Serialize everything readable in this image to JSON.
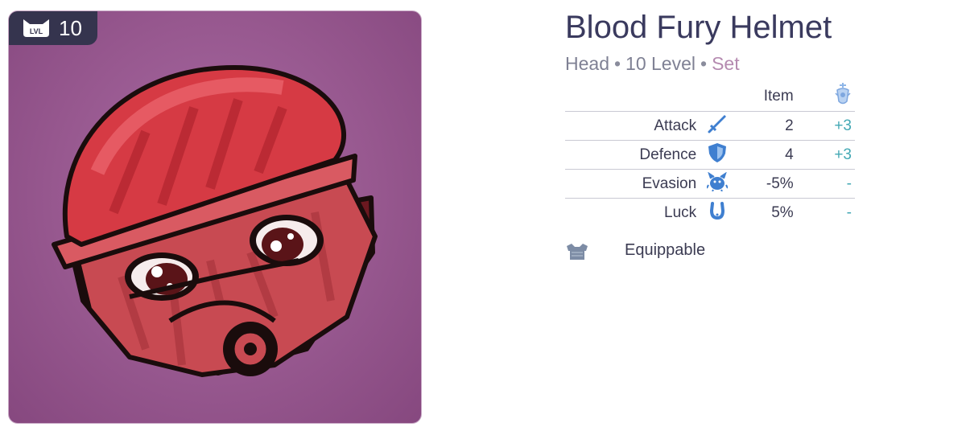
{
  "item": {
    "level_badge": "10",
    "name": "Blood Fury Helmet",
    "slot": "Head",
    "level_text": "10 Level",
    "separator": "•",
    "set_label": "Set"
  },
  "stats_table": {
    "header_item": "Item",
    "header_set_icon": "set-rune-icon",
    "rows": [
      {
        "label": "Attack",
        "icon": "sword-icon",
        "value": "2",
        "bonus": "+3"
      },
      {
        "label": "Defence",
        "icon": "shield-icon",
        "value": "4",
        "bonus": "+3"
      },
      {
        "label": "Evasion",
        "icon": "evasion-icon",
        "value": "-5%",
        "bonus": "-"
      },
      {
        "label": "Luck",
        "icon": "horseshoe-icon",
        "value": "5%",
        "bonus": "-"
      }
    ]
  },
  "equip": {
    "icon": "armor-icon",
    "label": "Equippable"
  },
  "colors": {
    "title": "#3a3a5e",
    "set": "#b58ab0",
    "bonus": "#43a8b4",
    "card_bg": "#97588f",
    "badge_bg": "#35344e",
    "icon_blue": "#3f7fd0"
  }
}
